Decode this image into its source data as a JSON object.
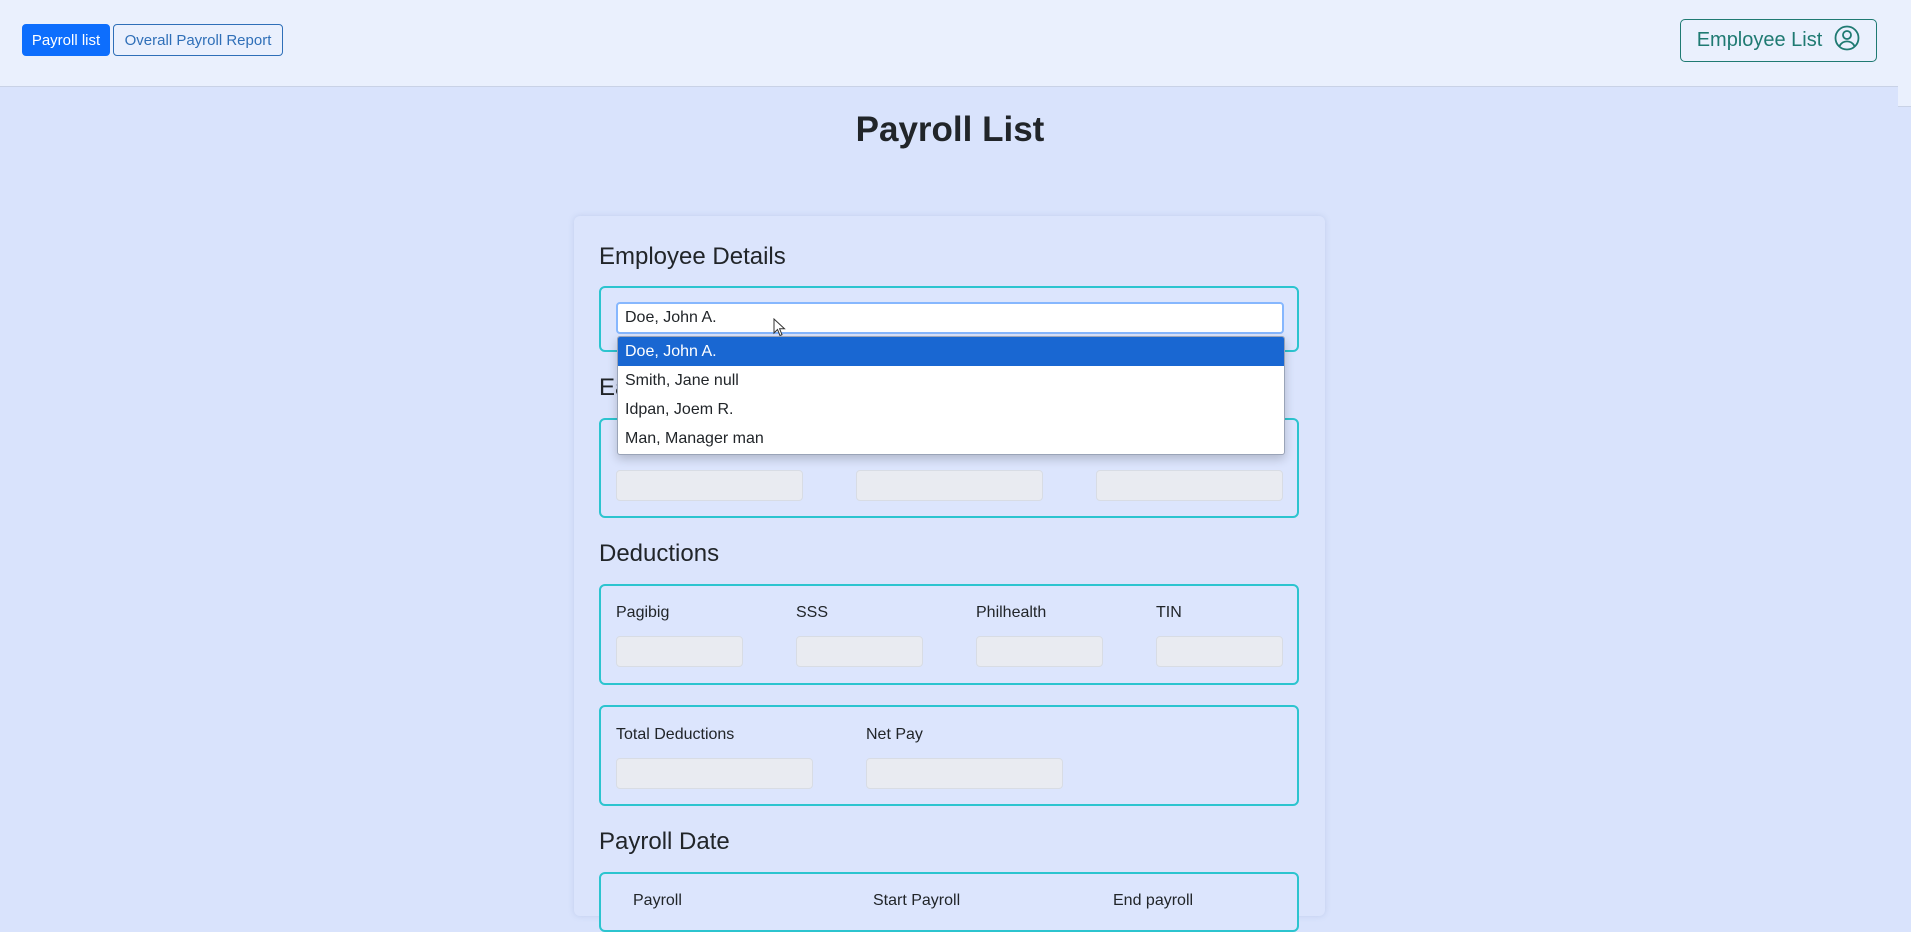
{
  "nav": {
    "payroll_list": "Payroll list",
    "overall_report": "Overall Payroll Report",
    "employee_list": "Employee List",
    "employee_list_icon": "user-circle-icon"
  },
  "page_title": "Payroll List",
  "employee_details": {
    "title": "Employee Details",
    "selected_value": "Doe, John A.",
    "options": [
      "Doe, John A.",
      "Smith, Jane null",
      "Idpan, Joem R.",
      "Man, Manager man"
    ],
    "selected_index": 0
  },
  "earnings": {
    "title_fragment": "Ea"
  },
  "deductions": {
    "title": "Deductions",
    "fields": [
      "Pagibig",
      "SSS",
      "Philhealth",
      "TIN"
    ]
  },
  "totals": {
    "total_deductions": "Total Deductions",
    "net_pay": "Net Pay"
  },
  "payroll_date": {
    "title": "Payroll Date",
    "fields": [
      "Payroll",
      "Start Payroll",
      "End payroll"
    ]
  },
  "colors": {
    "primary": "#0d6efd",
    "accent_border": "#2cc4cf",
    "teal_button": "#1f7a72",
    "page_bg": "#d9e3fc"
  }
}
